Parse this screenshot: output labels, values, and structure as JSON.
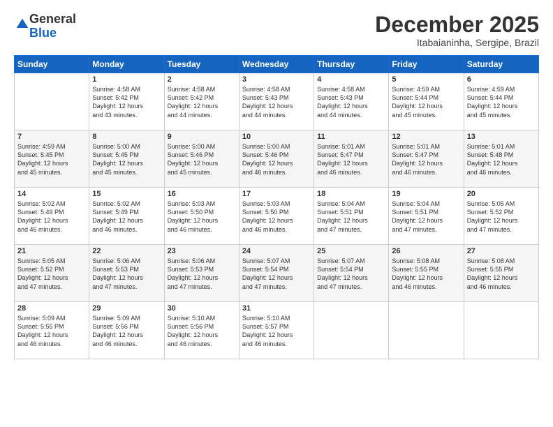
{
  "logo": {
    "general": "General",
    "blue": "Blue"
  },
  "header": {
    "month": "December 2025",
    "location": "Itabaianinha, Sergipe, Brazil"
  },
  "weekdays": [
    "Sunday",
    "Monday",
    "Tuesday",
    "Wednesday",
    "Thursday",
    "Friday",
    "Saturday"
  ],
  "weeks": [
    [
      {
        "day": "",
        "info": ""
      },
      {
        "day": "1",
        "info": "Sunrise: 4:58 AM\nSunset: 5:42 PM\nDaylight: 12 hours\nand 43 minutes."
      },
      {
        "day": "2",
        "info": "Sunrise: 4:58 AM\nSunset: 5:42 PM\nDaylight: 12 hours\nand 44 minutes."
      },
      {
        "day": "3",
        "info": "Sunrise: 4:58 AM\nSunset: 5:43 PM\nDaylight: 12 hours\nand 44 minutes."
      },
      {
        "day": "4",
        "info": "Sunrise: 4:58 AM\nSunset: 5:43 PM\nDaylight: 12 hours\nand 44 minutes."
      },
      {
        "day": "5",
        "info": "Sunrise: 4:59 AM\nSunset: 5:44 PM\nDaylight: 12 hours\nand 45 minutes."
      },
      {
        "day": "6",
        "info": "Sunrise: 4:59 AM\nSunset: 5:44 PM\nDaylight: 12 hours\nand 45 minutes."
      }
    ],
    [
      {
        "day": "7",
        "info": "Sunrise: 4:59 AM\nSunset: 5:45 PM\nDaylight: 12 hours\nand 45 minutes."
      },
      {
        "day": "8",
        "info": "Sunrise: 5:00 AM\nSunset: 5:45 PM\nDaylight: 12 hours\nand 45 minutes."
      },
      {
        "day": "9",
        "info": "Sunrise: 5:00 AM\nSunset: 5:46 PM\nDaylight: 12 hours\nand 45 minutes."
      },
      {
        "day": "10",
        "info": "Sunrise: 5:00 AM\nSunset: 5:46 PM\nDaylight: 12 hours\nand 46 minutes."
      },
      {
        "day": "11",
        "info": "Sunrise: 5:01 AM\nSunset: 5:47 PM\nDaylight: 12 hours\nand 46 minutes."
      },
      {
        "day": "12",
        "info": "Sunrise: 5:01 AM\nSunset: 5:47 PM\nDaylight: 12 hours\nand 46 minutes."
      },
      {
        "day": "13",
        "info": "Sunrise: 5:01 AM\nSunset: 5:48 PM\nDaylight: 12 hours\nand 46 minutes."
      }
    ],
    [
      {
        "day": "14",
        "info": "Sunrise: 5:02 AM\nSunset: 5:49 PM\nDaylight: 12 hours\nand 46 minutes."
      },
      {
        "day": "15",
        "info": "Sunrise: 5:02 AM\nSunset: 5:49 PM\nDaylight: 12 hours\nand 46 minutes."
      },
      {
        "day": "16",
        "info": "Sunrise: 5:03 AM\nSunset: 5:50 PM\nDaylight: 12 hours\nand 46 minutes."
      },
      {
        "day": "17",
        "info": "Sunrise: 5:03 AM\nSunset: 5:50 PM\nDaylight: 12 hours\nand 46 minutes."
      },
      {
        "day": "18",
        "info": "Sunrise: 5:04 AM\nSunset: 5:51 PM\nDaylight: 12 hours\nand 47 minutes."
      },
      {
        "day": "19",
        "info": "Sunrise: 5:04 AM\nSunset: 5:51 PM\nDaylight: 12 hours\nand 47 minutes."
      },
      {
        "day": "20",
        "info": "Sunrise: 5:05 AM\nSunset: 5:52 PM\nDaylight: 12 hours\nand 47 minutes."
      }
    ],
    [
      {
        "day": "21",
        "info": "Sunrise: 5:05 AM\nSunset: 5:52 PM\nDaylight: 12 hours\nand 47 minutes."
      },
      {
        "day": "22",
        "info": "Sunrise: 5:06 AM\nSunset: 5:53 PM\nDaylight: 12 hours\nand 47 minutes."
      },
      {
        "day": "23",
        "info": "Sunrise: 5:06 AM\nSunset: 5:53 PM\nDaylight: 12 hours\nand 47 minutes."
      },
      {
        "day": "24",
        "info": "Sunrise: 5:07 AM\nSunset: 5:54 PM\nDaylight: 12 hours\nand 47 minutes."
      },
      {
        "day": "25",
        "info": "Sunrise: 5:07 AM\nSunset: 5:54 PM\nDaylight: 12 hours\nand 47 minutes."
      },
      {
        "day": "26",
        "info": "Sunrise: 5:08 AM\nSunset: 5:55 PM\nDaylight: 12 hours\nand 46 minutes."
      },
      {
        "day": "27",
        "info": "Sunrise: 5:08 AM\nSunset: 5:55 PM\nDaylight: 12 hours\nand 46 minutes."
      }
    ],
    [
      {
        "day": "28",
        "info": "Sunrise: 5:09 AM\nSunset: 5:55 PM\nDaylight: 12 hours\nand 46 minutes."
      },
      {
        "day": "29",
        "info": "Sunrise: 5:09 AM\nSunset: 5:56 PM\nDaylight: 12 hours\nand 46 minutes."
      },
      {
        "day": "30",
        "info": "Sunrise: 5:10 AM\nSunset: 5:56 PM\nDaylight: 12 hours\nand 46 minutes."
      },
      {
        "day": "31",
        "info": "Sunrise: 5:10 AM\nSunset: 5:57 PM\nDaylight: 12 hours\nand 46 minutes."
      },
      {
        "day": "",
        "info": ""
      },
      {
        "day": "",
        "info": ""
      },
      {
        "day": "",
        "info": ""
      }
    ]
  ]
}
